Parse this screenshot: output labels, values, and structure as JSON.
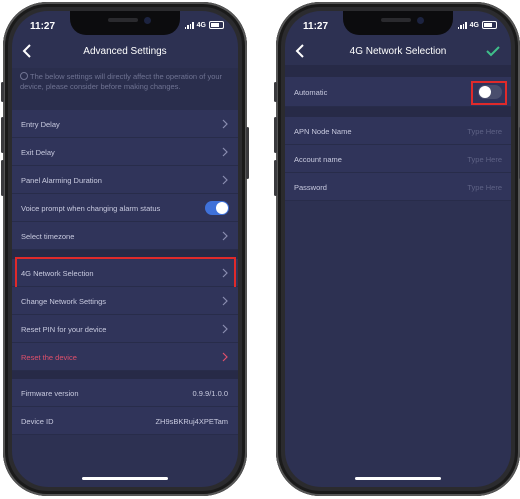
{
  "left_phone": {
    "time": "11:27",
    "network": "4G",
    "title": "Advanced Settings",
    "notice": "The below settings will directly affect the operation of your device, please consider before making changes.",
    "group1": [
      {
        "label": "Entry Delay"
      },
      {
        "label": "Exit Delay"
      },
      {
        "label": "Panel Alarming Duration"
      },
      {
        "label": "Voice prompt when changing alarm status",
        "toggle": true
      },
      {
        "label": "Select timezone"
      }
    ],
    "group2": [
      {
        "label": "4G Network Selection",
        "highlighted": true
      },
      {
        "label": "Change Network Settings"
      },
      {
        "label": "Reset PIN for your device"
      },
      {
        "label": "Reset the device",
        "danger": true
      }
    ],
    "info": [
      {
        "label": "Firmware version",
        "value": "0.9.9/1.0.0"
      },
      {
        "label": "Device ID",
        "value": "ZH9sBKRuj4XPETam"
      }
    ]
  },
  "right_phone": {
    "time": "11:27",
    "network": "4G",
    "title": "4G Network Selection",
    "automatic_label": "Automatic",
    "automatic_on": false,
    "fields": [
      {
        "label": "APN Node Name",
        "placeholder": "Type Here"
      },
      {
        "label": "Account name",
        "placeholder": "Type Here"
      },
      {
        "label": "Password",
        "placeholder": "Type Here"
      }
    ]
  },
  "colors": {
    "background": "#2d3152",
    "row": "#30345a",
    "accent_toggle": "#3f71d9",
    "danger": "#e0506c",
    "highlight_box": "#e02a2a",
    "check": "#3fbf8a"
  }
}
